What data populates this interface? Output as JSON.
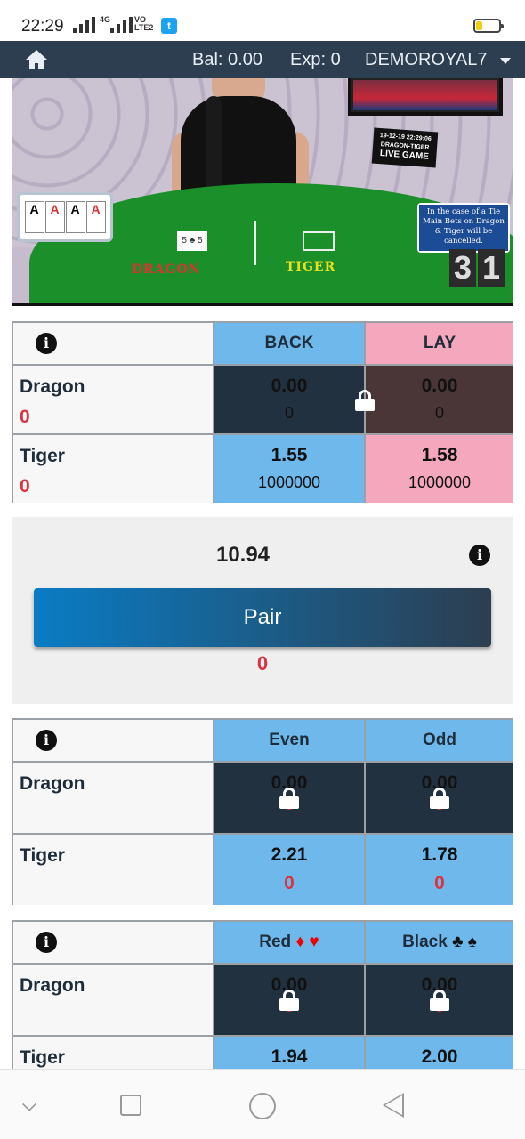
{
  "status_bar": {
    "time": "22:29",
    "network": "4G",
    "volte_line1": "VO",
    "volte_line2": "LTE2",
    "twitter_glyph": "t",
    "battery_level": 0.25
  },
  "top_nav": {
    "balance": "Bal: 0.00",
    "exposure": "Exp: 0",
    "username": "DEMOROYAL7"
  },
  "video": {
    "dragon_label": "DRAGON",
    "tiger_label": "TIGER",
    "live_badge_date": "19-12-19 22:29:06",
    "live_badge_sub": "DRAGON-TIGER",
    "live_badge_title": "LIVE GAME",
    "notice": "In the case of a Tie Main Bets on Dragon & Tiger will be cancelled.",
    "timer": [
      "3",
      "1"
    ],
    "aces": [
      "A",
      "A",
      "A",
      "A"
    ],
    "table_card": "5 ♣ 5"
  },
  "main_market": {
    "info_glyph": "i",
    "header_back": "BACK",
    "header_lay": "LAY",
    "rows": [
      {
        "name": "Dragon",
        "pl": "0",
        "back_odds": "0.00",
        "back_vol": "0",
        "lay_odds": "0.00",
        "lay_vol": "0",
        "suspended": true
      },
      {
        "name": "Tiger",
        "pl": "0",
        "back_odds": "1.55",
        "back_vol": "1000000",
        "lay_odds": "1.58",
        "lay_vol": "1000000",
        "suspended": false
      }
    ]
  },
  "pair_market": {
    "odds": "10.94",
    "button_label": "Pair",
    "pl": "0",
    "info_glyph": "i"
  },
  "even_odd_market": {
    "info_glyph": "i",
    "col1": "Even",
    "col2": "Odd",
    "rows": [
      {
        "name": "Dragon",
        "c1_odds": "0.00",
        "c1_pl": "0",
        "c2_odds": "0.00",
        "c2_pl": "0",
        "suspended": true
      },
      {
        "name": "Tiger",
        "c1_odds": "2.21",
        "c1_pl": "0",
        "c2_odds": "1.78",
        "c2_pl": "0",
        "suspended": false
      }
    ]
  },
  "color_market": {
    "info_glyph": "i",
    "col1": "Red",
    "col1_suits": "♦ ♥",
    "col2": "Black",
    "col2_suits": "♣ ♠",
    "rows": [
      {
        "name": "Dragon",
        "c1_odds": "0.00",
        "c1_pl": "0",
        "c2_odds": "0.00",
        "c2_pl": "0",
        "suspended": true
      },
      {
        "name": "Tiger",
        "c1_odds": "1.94",
        "c2_odds": "2.00",
        "suspended": false
      }
    ]
  },
  "colors": {
    "nav_bg": "#2c3e50",
    "back": "#6fb8ec",
    "lay": "#f5a8bd",
    "suspended": "#22313f",
    "loss": "#d9343f"
  }
}
